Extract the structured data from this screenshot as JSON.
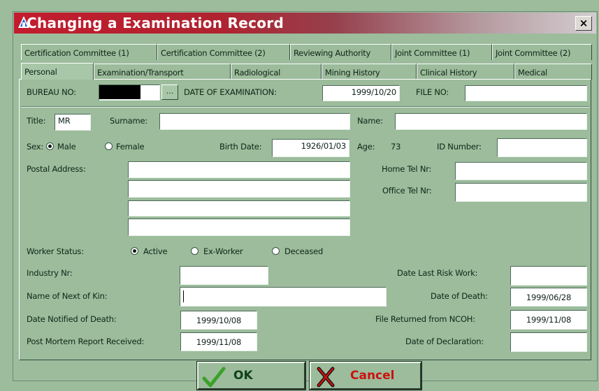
{
  "window": {
    "title": "Changing a Examination Record",
    "close_glyph": "×",
    "app_icon": "triangle-app-icon"
  },
  "tabs_row1": [
    {
      "label": "Certification Committee (1)"
    },
    {
      "label": "Certification Committee (2)"
    },
    {
      "label": "Reviewing Authority"
    },
    {
      "label": "Joint Committee (1)"
    },
    {
      "label": "Joint Committee (2)"
    }
  ],
  "tabs_row2": [
    {
      "label": "Personal",
      "active": true
    },
    {
      "label": "Examination/Transport"
    },
    {
      "label": "Radiological"
    },
    {
      "label": "Mining History"
    },
    {
      "label": "Clinical History"
    },
    {
      "label": "Medical"
    }
  ],
  "header_fields": {
    "bureau_label": "BUREAU NO:",
    "bureau_value": "",
    "lookup_label": "...",
    "exam_date_label": "DATE OF EXAMINATION:",
    "exam_date_value": "1999/10/20",
    "file_no_label": "FILE NO:",
    "file_no_value": ""
  },
  "personal": {
    "title_label": "Title:",
    "title_value": "MR",
    "surname_label": "Surname:",
    "surname_value": "",
    "name_label": "Name:",
    "name_value": "",
    "sex_label": "Sex:",
    "sex_options": [
      "Male",
      "Female"
    ],
    "sex_selected": "Male",
    "birth_label": "Birth Date:",
    "birth_value": "1926/01/03",
    "age_label": "Age:",
    "age_value": "73",
    "id_label": "ID Number:",
    "id_value": "",
    "postal_label": "Postal Address:",
    "postal_lines": [
      "",
      "",
      "",
      ""
    ],
    "home_tel_label": "Home Tel Nr:",
    "home_tel_value": "",
    "office_tel_label": "Office Tel Nr:",
    "office_tel_value": ""
  },
  "worker": {
    "status_label": "Worker Status:",
    "status_options": [
      "Active",
      "Ex-Worker",
      "Deceased"
    ],
    "status_selected": "Active",
    "industry_label": "Industry Nr:",
    "industry_value": "",
    "kin_label": "Name of Next of Kin:",
    "kin_value": "",
    "notified_label": "Date Notified of Death:",
    "notified_value": "1999/10/08",
    "postmortem_label": "Post Mortem Report Received:",
    "postmortem_value": "1999/11/08",
    "risk_label": "Date Last Risk Work:",
    "risk_value": "",
    "death_label": "Date of Death:",
    "death_value": "1999/06/28",
    "ncoh_label": "File Returned from NCOH:",
    "ncoh_value": "1999/11/08",
    "declaration_label": "Date of Declaration:",
    "declaration_value": ""
  },
  "buttons": {
    "ok_label": "OK",
    "cancel_label": "Cancel",
    "ok_icon": "checkmark-icon",
    "cancel_icon": "x-mark-icon"
  },
  "colors": {
    "background": "#9cbc9c",
    "title_gradient_start": "#c31c2e",
    "ok_check": "#3aa12a",
    "cancel_red": "#cc1111"
  }
}
